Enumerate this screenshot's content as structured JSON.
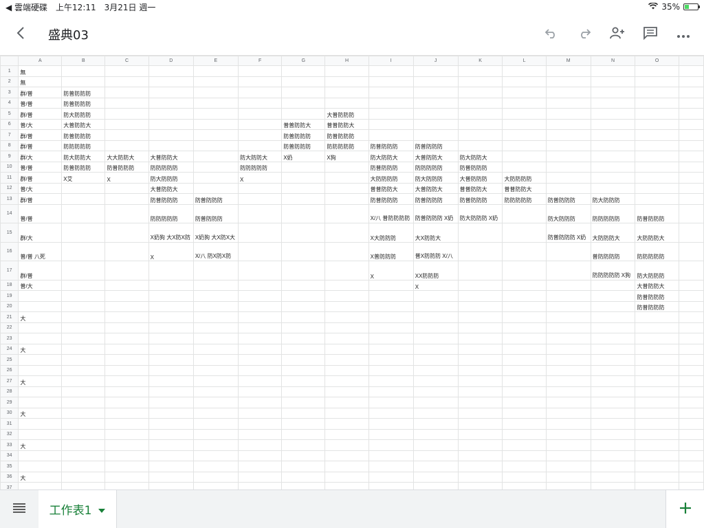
{
  "status": {
    "back_app": "◀ 雲端硬碟",
    "time": "上午12:11",
    "date": "3月21日 週一",
    "battery": "35%",
    "battery_level": 0.35
  },
  "header": {
    "title": "盛典03"
  },
  "sheet_tab": {
    "label": "工作表1"
  },
  "grid": {
    "columns": [
      "A",
      "B",
      "C",
      "D",
      "E",
      "F",
      "G",
      "H",
      "I",
      "J",
      "K",
      "L",
      "M",
      "N",
      "O"
    ],
    "rows": [
      {
        "n": "1",
        "cells": {
          "A": "無"
        }
      },
      {
        "n": "2",
        "cells": {
          "A": "無"
        }
      },
      {
        "n": "3",
        "cells": {
          "A": "群/普",
          "B": "防普防防防"
        }
      },
      {
        "n": "4",
        "cells": {
          "A": "普/普",
          "B": "防普防防防"
        }
      },
      {
        "n": "5",
        "cells": {
          "A": "群/普",
          "B": "防大防防防",
          "H": "大普防防防"
        }
      },
      {
        "n": "6",
        "cells": {
          "A": "普/大",
          "B": "大普防防大",
          "G": "普普防防大",
          "H": "普普防防大"
        }
      },
      {
        "n": "7",
        "cells": {
          "A": "群/普",
          "B": "防普防防防",
          "G": "防普防防防",
          "H": "防普防防防"
        }
      },
      {
        "n": "8",
        "cells": {
          "A": "群/普",
          "B": "防防防防防",
          "G": "防普防防防",
          "H": "防防防防防",
          "I": "防普防防防",
          "J": "防普防防防"
        }
      },
      {
        "n": "9",
        "cells": {
          "A": "群/大",
          "B": "防大防防大",
          "C": "大大防防大",
          "D": "大普防防大",
          "F": "防大防防大",
          "G": "X奶",
          "H": "X狗",
          "I": "防大防防大",
          "J": "大普防防大",
          "K": "防大防防大"
        }
      },
      {
        "n": "10",
        "cells": {
          "A": "普/普",
          "B": "防普防防防",
          "C": "防普防防防",
          "D": "防防防防防",
          "F": "防防防防防",
          "I": "防普防防防",
          "J": "防防防防防",
          "K": "防普防防防"
        }
      },
      {
        "n": "11",
        "cells": {
          "A": "群/普",
          "B": "X艾",
          "C": "X",
          "D": "防大防防防",
          "F": "X",
          "I": "大防防防防",
          "J": "防大防防防",
          "K": "大普防防防",
          "L": "大防防防防"
        }
      },
      {
        "n": "12",
        "cells": {
          "A": "普/大",
          "D": "大普防防大",
          "I": "普普防防大",
          "J": "大普防防大",
          "K": "普普防防大",
          "L": "普普防防大"
        }
      },
      {
        "n": "13",
        "cells": {
          "A": "群/普",
          "D": "防普防防防",
          "E": "防普防防防",
          "I": "防普防防防",
          "J": "防普防防防",
          "K": "防普防防防",
          "L": "防防防防防",
          "M": "防普防防防",
          "N": "防大防防防"
        }
      },
      {
        "n": "14",
        "tall": true,
        "cells": {
          "A": "普/普",
          "D": "防防防防防",
          "E": "防普防防防",
          "I": "X/八\n普防防防防",
          "J": "防普防防防\nX奶",
          "K": "防大防防防\nX奶",
          "M": "防大防防防",
          "N": "防防防防防",
          "O": "防普防防防"
        }
      },
      {
        "n": "15",
        "tall": true,
        "cells": {
          "A": "群/大",
          "D": "X奶狗\n大X防X防",
          "E": "X奶狗\n大X防X大",
          "I": "X大防防防",
          "J": "大X防防大",
          "M": "防普防防防\nX奶",
          "N": "大防防防大",
          "O": "大防防防大"
        }
      },
      {
        "n": "16",
        "tall": true,
        "cells": {
          "A": "普/普 八死",
          "D": "X",
          "E": "X/八\n防X防X防",
          "I": "X普防防防",
          "J": "普X防防防\nX/八",
          "N": "普防防防防",
          "O": "防防防防防"
        }
      },
      {
        "n": "17",
        "tall": true,
        "cells": {
          "A": "群/普",
          "I": "X",
          "J": "XX防防防",
          "N": "防防防防防\nX狗",
          "O": "防大防防防"
        }
      },
      {
        "n": "18",
        "cells": {
          "A": "普/大",
          "J": "X",
          "O": "大普防防大"
        }
      },
      {
        "n": "19",
        "cells": {
          "O": "防普防防防"
        }
      },
      {
        "n": "20",
        "cells": {
          "O": "防普防防防"
        }
      },
      {
        "n": "21",
        "cells": {
          "A": "大"
        }
      },
      {
        "n": "22",
        "cells": {}
      },
      {
        "n": "23",
        "cells": {}
      },
      {
        "n": "24",
        "cells": {
          "A": "大"
        }
      },
      {
        "n": "25",
        "cells": {}
      },
      {
        "n": "26",
        "cells": {}
      },
      {
        "n": "27",
        "cells": {
          "A": "大"
        }
      },
      {
        "n": "28",
        "cells": {}
      },
      {
        "n": "29",
        "cells": {}
      },
      {
        "n": "30",
        "cells": {
          "A": "大"
        }
      },
      {
        "n": "31",
        "cells": {}
      },
      {
        "n": "32",
        "cells": {}
      },
      {
        "n": "33",
        "cells": {
          "A": "大"
        }
      },
      {
        "n": "34",
        "cells": {}
      },
      {
        "n": "35",
        "cells": {}
      },
      {
        "n": "36",
        "cells": {
          "A": "大"
        }
      },
      {
        "n": "37",
        "cells": {}
      },
      {
        "n": "38",
        "cells": {}
      }
    ]
  },
  "icons": {
    "back": "chevron-left-icon",
    "undo": "undo-icon",
    "redo": "redo-icon",
    "share": "add-person-icon",
    "comments": "comment-icon",
    "more": "more-horizontal-icon",
    "sheets_menu": "sheet-list-icon",
    "add_sheet": "plus-icon"
  },
  "colors": {
    "accent": "#188038",
    "battery": "#4cd964"
  }
}
